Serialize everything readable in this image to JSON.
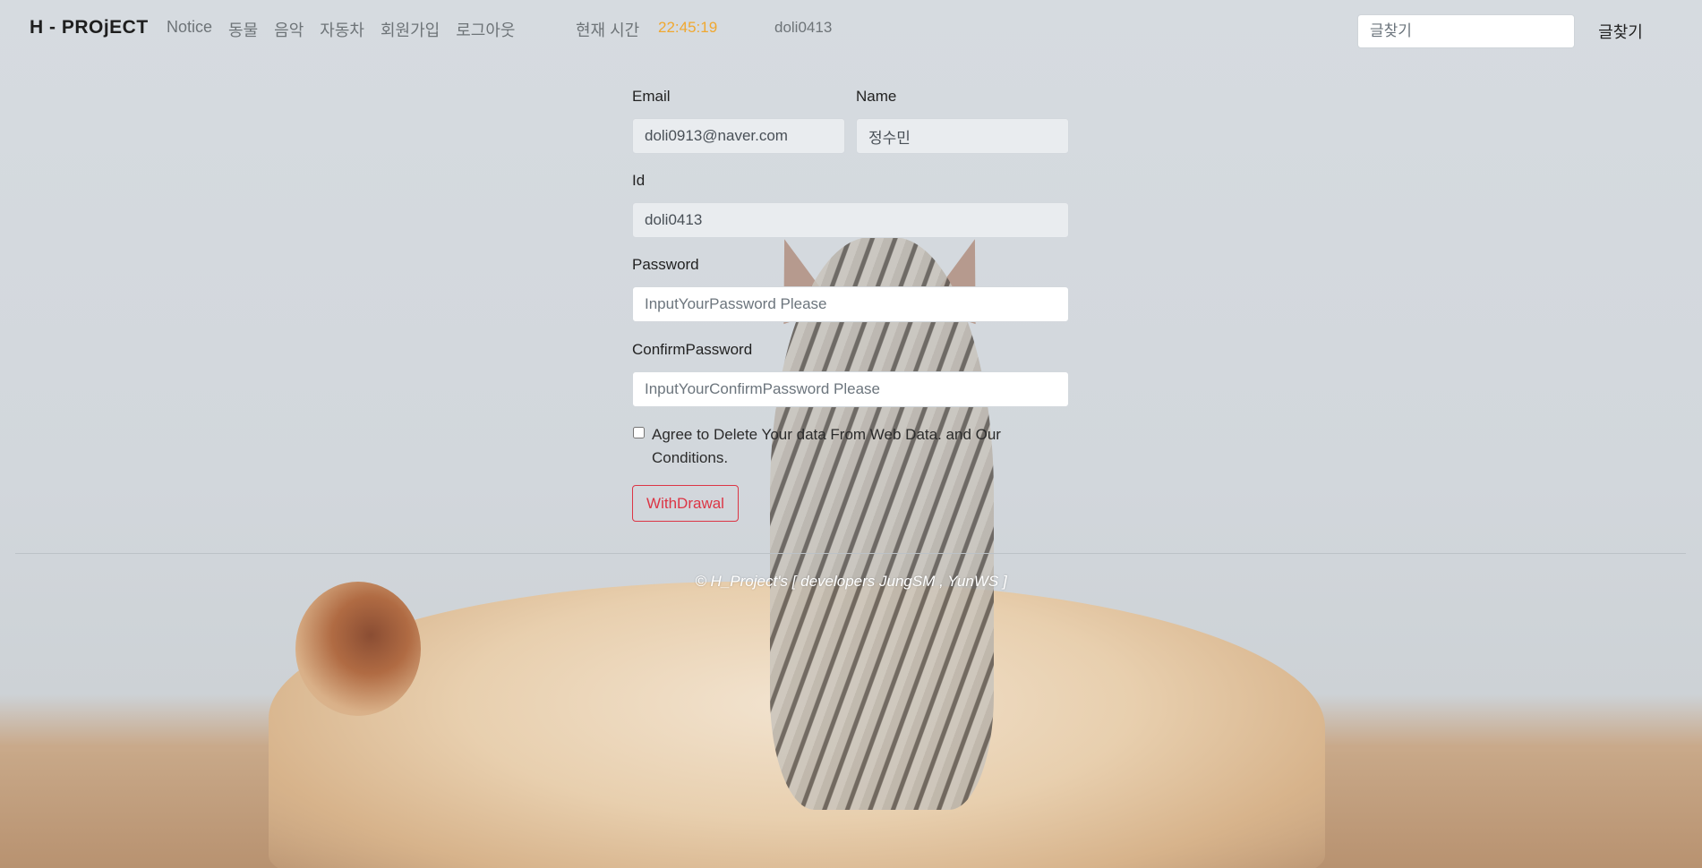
{
  "navbar": {
    "brand": "H - PROjECT",
    "links": [
      "Notice",
      "동물",
      "음악",
      "자동차",
      "회원가입",
      "로그아웃"
    ],
    "time_label": "현재 시간",
    "time_value": "22:45:19",
    "user_id": "doli0413",
    "search_placeholder": "글찾기",
    "search_button": "글찾기"
  },
  "form": {
    "email_label": "Email",
    "email_value": "doli0913@naver.com",
    "name_label": "Name",
    "name_value": "정수민",
    "id_label": "Id",
    "id_value": "doli0413",
    "password_label": "Password",
    "password_placeholder": "InputYourPassword Please",
    "confirm_label": "ConfirmPassword",
    "confirm_placeholder": "InputYourConfirmPassword Please",
    "agree_text": "Agree to Delete Your data From Web Data. and Our Conditions.",
    "withdraw_button": "WithDrawal"
  },
  "footer": {
    "text": "© H_Project's [ developers JungSM , YunWS ]"
  },
  "colors": {
    "time_accent": "#f0a830",
    "danger": "#dc3545"
  }
}
